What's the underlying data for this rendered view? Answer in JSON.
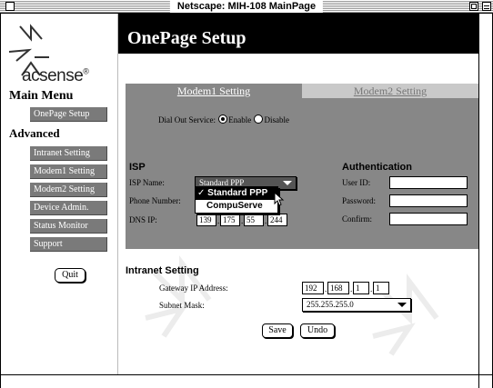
{
  "window": {
    "title": "Netscape: MIH-108 MainPage"
  },
  "brand": {
    "logo_text": "acsense",
    "logo_mark": "®"
  },
  "sidebar": {
    "main_menu_heading": "Main Menu",
    "onepage_button": "OnePage Setup",
    "advanced_heading": "Advanced",
    "items": [
      {
        "label": "Intranet Setting"
      },
      {
        "label": "Modem1 Setting"
      },
      {
        "label": "Modem2 Setting"
      },
      {
        "label": "Device Admin."
      },
      {
        "label": "Status Monitor"
      },
      {
        "label": "Support"
      }
    ],
    "quit_label": "Quit"
  },
  "header": {
    "title": "OnePage Setup"
  },
  "tabs": [
    {
      "label": "Modem1 Setting",
      "active": true
    },
    {
      "label": "Modem2 Setting",
      "active": false
    }
  ],
  "dialout": {
    "label": "Dial Out Service:",
    "enable_label": "Enable",
    "disable_label": "Disable",
    "selected": "Enable"
  },
  "isp": {
    "section_title": "ISP",
    "name_label": "ISP Name:",
    "name_value": "Standard PPP",
    "phone_label": "Phone Number:",
    "dns_label": "DNS IP:",
    "dns_octets": [
      "139",
      "175",
      "55",
      "244"
    ],
    "dropdown_options": [
      {
        "label": "✓ Standard PPP",
        "selected": true
      },
      {
        "label": "CompuServe",
        "selected": false
      }
    ]
  },
  "auth": {
    "section_title": "Authentication",
    "user_label": "User ID:",
    "password_label": "Password:",
    "confirm_label": "Confirm:",
    "user_value": "",
    "password_value": "",
    "confirm_value": ""
  },
  "intranet": {
    "section_title": "Intranet Setting",
    "gateway_label": "Gateway IP Address:",
    "gateway_octets": [
      "192",
      "168",
      "1",
      "1"
    ],
    "subnet_label": "Subnet Mask:",
    "subnet_value": "255.255.255.0"
  },
  "actions": {
    "save_label": "Save",
    "undo_label": "Undo"
  },
  "colors": {
    "panel_bg": "#878787",
    "nav_button_bg": "#7a7a7a",
    "header_bg": "#000000",
    "inactive_tab_bg": "#c9c9c9"
  }
}
